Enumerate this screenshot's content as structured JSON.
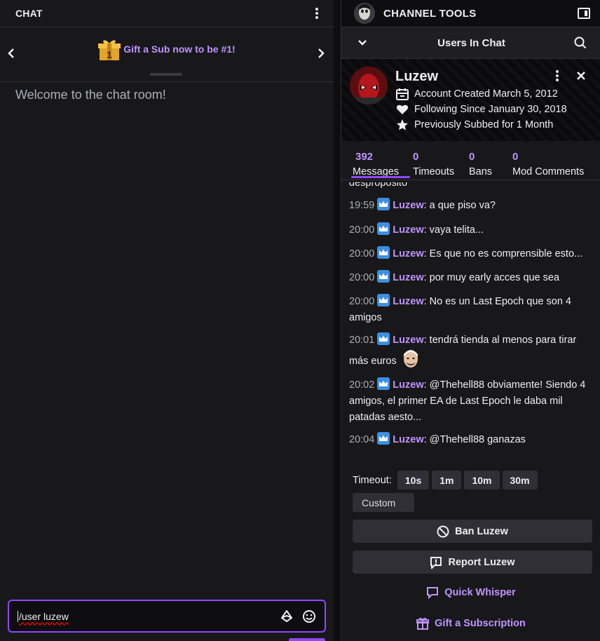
{
  "chat": {
    "title": "CHAT",
    "gift_promo": "Gift a Sub now to be #1!",
    "gift_badge_number": "1",
    "welcome": "Welcome to the chat room!",
    "input_value": "/user luzew"
  },
  "tools": {
    "title": "CHANNEL TOOLS",
    "users_title": "Users In Chat",
    "profile": {
      "name": "Luzew",
      "account_created": "Account Created March 5, 2012",
      "following": "Following Since January 30, 2018",
      "subbed": "Previously Subbed for 1 Month"
    },
    "stats": [
      {
        "count": "392",
        "label": "Messages"
      },
      {
        "count": "0",
        "label": "Timeouts"
      },
      {
        "count": "0",
        "label": "Bans"
      },
      {
        "count": "0",
        "label": "Mod Comments"
      }
    ],
    "clipped_text": "desproposito",
    "messages": [
      {
        "time": "19:59",
        "user": "Luzew",
        "text": ": a que piso va?"
      },
      {
        "time": "20:00",
        "user": "Luzew",
        "text": ": vaya telita..."
      },
      {
        "time": "20:00",
        "user": "Luzew",
        "text": ": Es que no es comprensible esto..."
      },
      {
        "time": "20:00",
        "user": "Luzew",
        "text": ": por muy early acces que sea"
      },
      {
        "time": "20:00",
        "user": "Luzew",
        "text": ": No es un Last Epoch que son 4 amigos"
      },
      {
        "time": "20:01",
        "user": "Luzew",
        "text": ": tendrá tienda al menos para tirar más euros"
      },
      {
        "time": "20:02",
        "user": "Luzew",
        "text": ": @Thehell88 obviamente! Siendo 4 amigos, el primer EA de Last Epoch le daba mil patadas aesto..."
      },
      {
        "time": "20:04",
        "user": "Luzew",
        "text": ": @Thehell88 ganazas"
      }
    ],
    "timeout_label": "Timeout:",
    "timeout_options": [
      "10s",
      "1m",
      "10m",
      "30m"
    ],
    "custom_label": "Custom",
    "ban_label": "Ban Luzew",
    "report_label": "Report Luzew",
    "whisper_label": "Quick Whisper",
    "gift_sub_label": "Gift a Subscription"
  },
  "colors": {
    "accent": "#bf94ff",
    "accent_strong": "#9147ff",
    "background": "#18181b",
    "button": "#2f2f35",
    "badge": "#3c8fe0"
  },
  "icons": [
    "kebab-icon",
    "chevron-left-icon",
    "chevron-right-icon",
    "gift-icon",
    "bits-icon",
    "emote-picker-icon",
    "sidebar-toggle-icon",
    "chevron-down-icon",
    "search-icon",
    "close-icon",
    "calendar-icon",
    "heart-icon",
    "star-icon",
    "crown-badge-icon",
    "ban-icon",
    "report-icon",
    "whisper-icon"
  ]
}
